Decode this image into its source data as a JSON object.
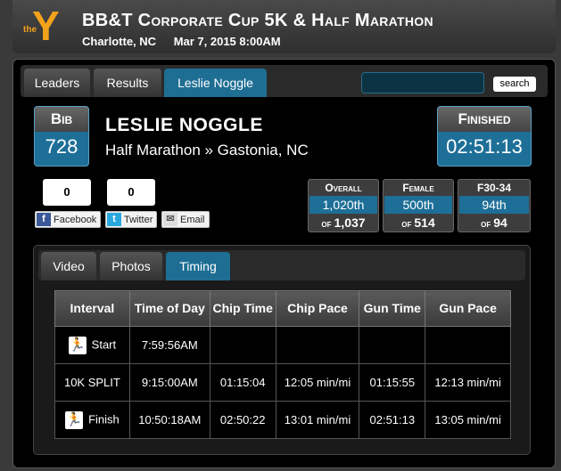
{
  "header": {
    "logo_text": "the",
    "logo_letter": "Y",
    "title": "BB&T Corporate Cup 5K & Half Marathon",
    "location": "Charlotte, NC",
    "datetime": "Mar 7, 2015 8:00AM"
  },
  "tabs": [
    {
      "label": "Leaders"
    },
    {
      "label": "Results"
    },
    {
      "label": "Leslie Noggle"
    }
  ],
  "search": {
    "button_label": "search",
    "value": ""
  },
  "runner": {
    "bib_label": "Bib",
    "bib": "728",
    "name": "LESLIE NOGGLE",
    "race": "Half Marathon » Gastonia, NC",
    "status_label": "Finished",
    "finish_time": "02:51:13"
  },
  "share": {
    "facebook_count": "0",
    "twitter_count": "0",
    "facebook_label": "Facebook",
    "twitter_label": "Twitter",
    "email_label": "Email"
  },
  "ranks": [
    {
      "label": "Overall",
      "place": "1,020th",
      "of_label": "of",
      "total": "1,037"
    },
    {
      "label": "Female",
      "place": "500th",
      "of_label": "of",
      "total": "514"
    },
    {
      "label": "F30-34",
      "place": "94th",
      "of_label": "of",
      "total": "94"
    }
  ],
  "inner_tabs": [
    {
      "label": "Video"
    },
    {
      "label": "Photos"
    },
    {
      "label": "Timing"
    }
  ],
  "timing": {
    "headers": [
      "Interval",
      "Time of Day",
      "Chip Time",
      "Chip Pace",
      "Gun Time",
      "Gun Pace"
    ],
    "rows": [
      {
        "interval": "Start",
        "icon": "runner-icon",
        "time_of_day": "7:59:56AM",
        "chip_time": "",
        "chip_pace": "",
        "gun_time": "",
        "gun_pace": ""
      },
      {
        "interval": "10K SPLIT",
        "icon": "",
        "time_of_day": "9:15:00AM",
        "chip_time": "01:15:04",
        "chip_pace": "12:05 min/mi",
        "gun_time": "01:15:55",
        "gun_pace": "12:13 min/mi"
      },
      {
        "interval": "Finish",
        "icon": "runner-icon",
        "time_of_day": "10:50:18AM",
        "chip_time": "02:50:22",
        "chip_pace": "13:01 min/mi",
        "gun_time": "02:51:13",
        "gun_pace": "13:05 min/mi"
      }
    ]
  },
  "colors": {
    "accent": "#1d6f97",
    "logo": "#f4a21c"
  }
}
